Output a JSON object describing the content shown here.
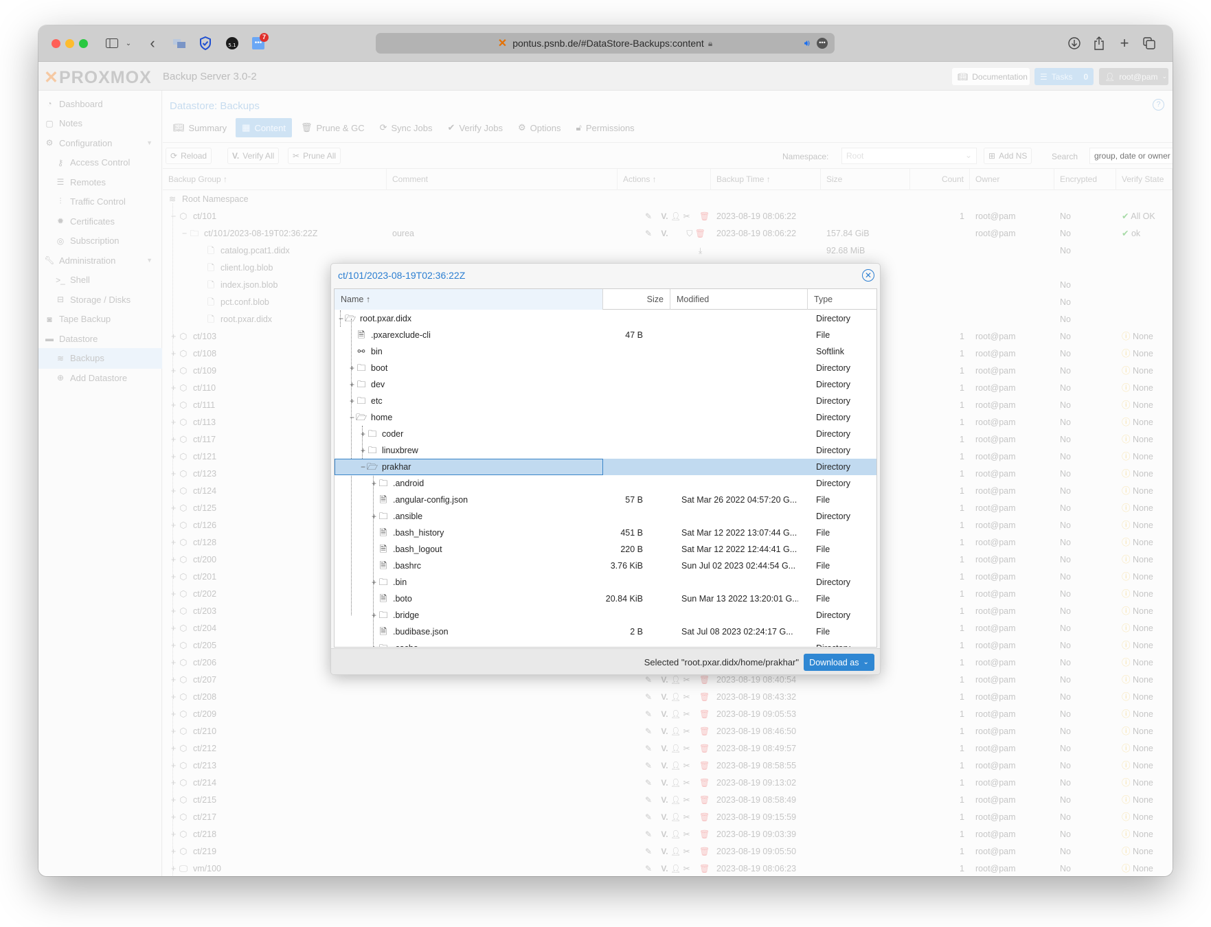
{
  "browser": {
    "url": "pontus.psnb.de/#DataStore-Backups:content",
    "extension_badge": "7"
  },
  "app": {
    "brand": "PROXMOX",
    "product": "Backup Server 3.0-2",
    "documentation_label": "Documentation",
    "tasks_label": "Tasks",
    "tasks_count": "0",
    "user_label": "root@pam"
  },
  "sidebar": {
    "items": [
      {
        "label": "Dashboard",
        "icon": "dashboard-icon",
        "level": 0
      },
      {
        "label": "Notes",
        "icon": "notes-icon",
        "level": 0
      },
      {
        "label": "Configuration",
        "icon": "gears-icon",
        "level": 0,
        "expandable": true
      },
      {
        "label": "Access Control",
        "icon": "key-icon",
        "level": 1
      },
      {
        "label": "Remotes",
        "icon": "server-icon",
        "level": 1
      },
      {
        "label": "Traffic Control",
        "icon": "bar-chart-icon",
        "level": 1
      },
      {
        "label": "Certificates",
        "icon": "certificate-icon",
        "level": 1
      },
      {
        "label": "Subscription",
        "icon": "life-ring-icon",
        "level": 1
      },
      {
        "label": "Administration",
        "icon": "wrench-icon",
        "level": 0,
        "expandable": true
      },
      {
        "label": "Shell",
        "icon": "terminal-icon",
        "level": 1
      },
      {
        "label": "Storage / Disks",
        "icon": "hdd-icon",
        "level": 1
      },
      {
        "label": "Tape Backup",
        "icon": "tape-icon",
        "level": 0
      },
      {
        "label": "Datastore",
        "icon": "archive-icon",
        "level": 0
      },
      {
        "label": "Backups",
        "icon": "database-icon",
        "level": 1,
        "active": true
      },
      {
        "label": "Add Datastore",
        "icon": "plus-circle-icon",
        "level": 1
      }
    ]
  },
  "datastore": {
    "title": "Datastore: Backups",
    "tabs": [
      {
        "label": "Summary",
        "icon": "book-icon"
      },
      {
        "label": "Content",
        "icon": "grid-icon",
        "active": true
      },
      {
        "label": "Prune & GC",
        "icon": "trash-icon"
      },
      {
        "label": "Sync Jobs",
        "icon": "refresh-icon"
      },
      {
        "label": "Verify Jobs",
        "icon": "check-circle-icon"
      },
      {
        "label": "Options",
        "icon": "gear-icon"
      },
      {
        "label": "Permissions",
        "icon": "unlock-icon"
      }
    ],
    "toolbar": {
      "reload": "Reload",
      "verify_all": "Verify All",
      "prune_all": "Prune All",
      "namespace_label": "Namespace:",
      "namespace_value": "Root",
      "add_ns": "Add NS",
      "search_label": "Search",
      "search_placeholder": "group, date or owner"
    },
    "columns": [
      "Backup Group ↑",
      "Comment",
      "Actions ↑",
      "Backup Time ↑",
      "Size",
      "Count",
      "Owner",
      "Encrypted",
      "Verify State"
    ],
    "root_namespace": "Root Namespace",
    "rows": [
      {
        "name": "ct/101",
        "kind": "group",
        "expanded": true,
        "time": "2023-08-19 08:06:22",
        "count": "1",
        "owner": "root@pam",
        "encrypted": "No",
        "verify": "All OK",
        "verify_state": "ok"
      },
      {
        "name": "ct/101/2023-08-19T02:36:22Z",
        "kind": "snapshot",
        "comment": "ourea",
        "time": "2023-08-19 08:06:22",
        "size": "157.84 GiB",
        "owner": "root@pam",
        "encrypted": "No",
        "verify": "ok",
        "verify_state": "ok"
      },
      {
        "name": "catalog.pcat1.didx",
        "kind": "file",
        "size": "92.68 MiB",
        "encrypted": "No"
      },
      {
        "name": "client.log.blob",
        "kind": "file"
      },
      {
        "name": "index.json.blob",
        "kind": "file",
        "encrypted": "No"
      },
      {
        "name": "pct.conf.blob",
        "kind": "file",
        "encrypted": "No"
      },
      {
        "name": "root.pxar.didx",
        "kind": "file",
        "encrypted": "No"
      },
      {
        "name": "ct/103",
        "kind": "group",
        "count": "1",
        "owner": "root@pam",
        "encrypted": "No",
        "verify": "None"
      },
      {
        "name": "ct/108",
        "kind": "group",
        "count": "1",
        "owner": "root@pam",
        "encrypted": "No",
        "verify": "None"
      },
      {
        "name": "ct/109",
        "kind": "group",
        "count": "1",
        "owner": "root@pam",
        "encrypted": "No",
        "verify": "None"
      },
      {
        "name": "ct/110",
        "kind": "group",
        "count": "1",
        "owner": "root@pam",
        "encrypted": "No",
        "verify": "None"
      },
      {
        "name": "ct/111",
        "kind": "group",
        "count": "1",
        "owner": "root@pam",
        "encrypted": "No",
        "verify": "None"
      },
      {
        "name": "ct/113",
        "kind": "group",
        "count": "1",
        "owner": "root@pam",
        "encrypted": "No",
        "verify": "None"
      },
      {
        "name": "ct/117",
        "kind": "group",
        "count": "1",
        "owner": "root@pam",
        "encrypted": "No",
        "verify": "None"
      },
      {
        "name": "ct/121",
        "kind": "group",
        "count": "1",
        "owner": "root@pam",
        "encrypted": "No",
        "verify": "None"
      },
      {
        "name": "ct/123",
        "kind": "group",
        "count": "1",
        "owner": "root@pam",
        "encrypted": "No",
        "verify": "None"
      },
      {
        "name": "ct/124",
        "kind": "group",
        "count": "1",
        "owner": "root@pam",
        "encrypted": "No",
        "verify": "None"
      },
      {
        "name": "ct/125",
        "kind": "group",
        "count": "1",
        "owner": "root@pam",
        "encrypted": "No",
        "verify": "None"
      },
      {
        "name": "ct/126",
        "kind": "group",
        "count": "1",
        "owner": "root@pam",
        "encrypted": "No",
        "verify": "None"
      },
      {
        "name": "ct/128",
        "kind": "group",
        "count": "1",
        "owner": "root@pam",
        "encrypted": "No",
        "verify": "None"
      },
      {
        "name": "ct/200",
        "kind": "group",
        "count": "1",
        "owner": "root@pam",
        "encrypted": "No",
        "verify": "None"
      },
      {
        "name": "ct/201",
        "kind": "group",
        "count": "1",
        "owner": "root@pam",
        "encrypted": "No",
        "verify": "None"
      },
      {
        "name": "ct/202",
        "kind": "group",
        "count": "1",
        "owner": "root@pam",
        "encrypted": "No",
        "verify": "None"
      },
      {
        "name": "ct/203",
        "kind": "group",
        "count": "1",
        "owner": "root@pam",
        "encrypted": "No",
        "verify": "None"
      },
      {
        "name": "ct/204",
        "kind": "group",
        "count": "1",
        "owner": "root@pam",
        "encrypted": "No",
        "verify": "None"
      },
      {
        "name": "ct/205",
        "kind": "group",
        "count": "1",
        "owner": "root@pam",
        "encrypted": "No",
        "verify": "None"
      },
      {
        "name": "ct/206",
        "kind": "group",
        "count": "1",
        "owner": "root@pam",
        "encrypted": "No",
        "verify": "None"
      },
      {
        "name": "ct/207",
        "kind": "group",
        "time": "2023-08-19 08:40:54",
        "count": "1",
        "owner": "root@pam",
        "encrypted": "No",
        "verify": "None"
      },
      {
        "name": "ct/208",
        "kind": "group",
        "time": "2023-08-19 08:43:32",
        "count": "1",
        "owner": "root@pam",
        "encrypted": "No",
        "verify": "None"
      },
      {
        "name": "ct/209",
        "kind": "group",
        "time": "2023-08-19 09:05:53",
        "count": "1",
        "owner": "root@pam",
        "encrypted": "No",
        "verify": "None"
      },
      {
        "name": "ct/210",
        "kind": "group",
        "time": "2023-08-19 08:46:50",
        "count": "1",
        "owner": "root@pam",
        "encrypted": "No",
        "verify": "None"
      },
      {
        "name": "ct/212",
        "kind": "group",
        "time": "2023-08-19 08:49:57",
        "count": "1",
        "owner": "root@pam",
        "encrypted": "No",
        "verify": "None"
      },
      {
        "name": "ct/213",
        "kind": "group",
        "time": "2023-08-19 08:58:55",
        "count": "1",
        "owner": "root@pam",
        "encrypted": "No",
        "verify": "None"
      },
      {
        "name": "ct/214",
        "kind": "group",
        "time": "2023-08-19 09:13:02",
        "count": "1",
        "owner": "root@pam",
        "encrypted": "No",
        "verify": "None"
      },
      {
        "name": "ct/215",
        "kind": "group",
        "time": "2023-08-19 08:58:49",
        "count": "1",
        "owner": "root@pam",
        "encrypted": "No",
        "verify": "None"
      },
      {
        "name": "ct/217",
        "kind": "group",
        "time": "2023-08-19 09:15:59",
        "count": "1",
        "owner": "root@pam",
        "encrypted": "No",
        "verify": "None"
      },
      {
        "name": "ct/218",
        "kind": "group",
        "time": "2023-08-19 09:03:39",
        "count": "1",
        "owner": "root@pam",
        "encrypted": "No",
        "verify": "None"
      },
      {
        "name": "ct/219",
        "kind": "group",
        "time": "2023-08-19 09:05:50",
        "count": "1",
        "owner": "root@pam",
        "encrypted": "No",
        "verify": "None"
      },
      {
        "name": "vm/100",
        "kind": "vm",
        "time": "2023-08-19 08:06:23",
        "count": "1",
        "owner": "root@pam",
        "encrypted": "No",
        "verify": "None"
      }
    ]
  },
  "file_browser": {
    "title": "ct/101/2023-08-19T02:36:22Z",
    "columns": {
      "name": "Name ↑",
      "size": "Size",
      "modified": "Modified",
      "type": "Type"
    },
    "rows": [
      {
        "name": "root.pxar.didx",
        "depth": 0,
        "kind": "dir-open",
        "toggle": "−",
        "size": "",
        "modified": "",
        "type": "Directory"
      },
      {
        "name": ".pxarexclude-cli",
        "depth": 1,
        "kind": "file",
        "toggle": "",
        "size": "47 B",
        "modified": "",
        "type": "File"
      },
      {
        "name": "bin",
        "depth": 1,
        "kind": "link",
        "toggle": "",
        "size": "",
        "modified": "",
        "type": "Softlink"
      },
      {
        "name": "boot",
        "depth": 1,
        "kind": "dir",
        "toggle": "+",
        "size": "",
        "modified": "",
        "type": "Directory"
      },
      {
        "name": "dev",
        "depth": 1,
        "kind": "dir",
        "toggle": "+",
        "size": "",
        "modified": "",
        "type": "Directory"
      },
      {
        "name": "etc",
        "depth": 1,
        "kind": "dir",
        "toggle": "+",
        "size": "",
        "modified": "",
        "type": "Directory"
      },
      {
        "name": "home",
        "depth": 1,
        "kind": "dir-open",
        "toggle": "−",
        "size": "",
        "modified": "",
        "type": "Directory"
      },
      {
        "name": "coder",
        "depth": 2,
        "kind": "dir",
        "toggle": "+",
        "size": "",
        "modified": "",
        "type": "Directory"
      },
      {
        "name": "linuxbrew",
        "depth": 2,
        "kind": "dir",
        "toggle": "+",
        "size": "",
        "modified": "",
        "type": "Directory"
      },
      {
        "name": "prakhar",
        "depth": 2,
        "kind": "dir-open",
        "toggle": "−",
        "size": "",
        "modified": "",
        "type": "Directory",
        "selected": true
      },
      {
        "name": ".android",
        "depth": 3,
        "kind": "dir",
        "toggle": "+",
        "size": "",
        "modified": "",
        "type": "Directory"
      },
      {
        "name": ".angular-config.json",
        "depth": 3,
        "kind": "file",
        "toggle": "",
        "size": "57 B",
        "modified": "Sat Mar 26 2022 04:57:20 G...",
        "type": "File"
      },
      {
        "name": ".ansible",
        "depth": 3,
        "kind": "dir",
        "toggle": "+",
        "size": "",
        "modified": "",
        "type": "Directory"
      },
      {
        "name": ".bash_history",
        "depth": 3,
        "kind": "file",
        "toggle": "",
        "size": "451 B",
        "modified": "Sat Mar 12 2022 13:07:44 G...",
        "type": "File"
      },
      {
        "name": ".bash_logout",
        "depth": 3,
        "kind": "file",
        "toggle": "",
        "size": "220 B",
        "modified": "Sat Mar 12 2022 12:44:41 G...",
        "type": "File"
      },
      {
        "name": ".bashrc",
        "depth": 3,
        "kind": "file",
        "toggle": "",
        "size": "3.76 KiB",
        "modified": "Sun Jul 02 2023 02:44:54 G...",
        "type": "File"
      },
      {
        "name": ".bin",
        "depth": 3,
        "kind": "dir",
        "toggle": "+",
        "size": "",
        "modified": "",
        "type": "Directory"
      },
      {
        "name": ".boto",
        "depth": 3,
        "kind": "file",
        "toggle": "",
        "size": "20.84 KiB",
        "modified": "Sun Mar 13 2022 13:20:01 G...",
        "type": "File"
      },
      {
        "name": ".bridge",
        "depth": 3,
        "kind": "dir",
        "toggle": "+",
        "size": "",
        "modified": "",
        "type": "Directory"
      },
      {
        "name": ".budibase.json",
        "depth": 3,
        "kind": "file",
        "toggle": "",
        "size": "2 B",
        "modified": "Sat Jul 08 2023 02:24:17 G...",
        "type": "File"
      },
      {
        "name": ".cache",
        "depth": 3,
        "kind": "dir",
        "toggle": "+",
        "size": "",
        "modified": "",
        "type": "Directory"
      }
    ],
    "selected_text": "Selected \"root.pxar.didx/home/prakhar\"",
    "download_label": "Download as"
  }
}
